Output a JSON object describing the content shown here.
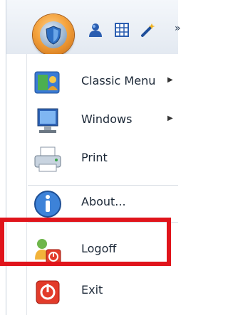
{
  "toolbar": {
    "orb_icon": "shield-orb-icon",
    "quick_access": [
      "people-icon",
      "grid-icon",
      "wand-icon"
    ],
    "overflow_icon": "chevron-right-icon"
  },
  "menu": {
    "items": [
      {
        "label": "Classic Menu",
        "icon": "classic-menu-icon",
        "has_submenu": true
      },
      {
        "label": "Windows",
        "icon": "monitor-icon",
        "has_submenu": true
      },
      {
        "label": "Print",
        "icon": "printer-icon",
        "has_submenu": false
      },
      {
        "label": "About...",
        "icon": "info-icon",
        "has_submenu": false
      },
      {
        "label": "Logoff",
        "icon": "logoff-icon",
        "has_submenu": false
      },
      {
        "label": "Exit",
        "icon": "power-icon",
        "has_submenu": false
      }
    ],
    "submenu_arrow": "▶"
  },
  "highlight_color": "#e0141b"
}
